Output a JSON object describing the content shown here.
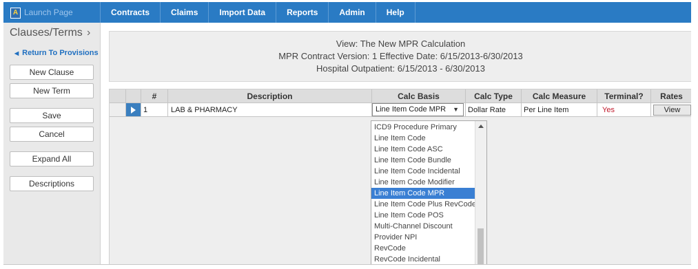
{
  "app": {
    "launch_label": "Launch Page",
    "logo_letter": "A"
  },
  "nav": {
    "items": [
      {
        "label": "Contracts"
      },
      {
        "label": "Claims"
      },
      {
        "label": "Import Data"
      },
      {
        "label": "Reports"
      },
      {
        "label": "Admin"
      },
      {
        "label": "Help"
      }
    ]
  },
  "sidebar": {
    "title": "Clauses/Terms",
    "chevron_icon": "chevron-right-icon",
    "return_link": "Return To Provisions",
    "buttons": {
      "new_clause": "New Clause",
      "new_term": "New Term",
      "save": "Save",
      "cancel": "Cancel",
      "expand_all": "Expand All",
      "descriptions": "Descriptions"
    }
  },
  "header": {
    "line1": "View: The New MPR Calculation",
    "line2": "MPR Contract Version: 1 Effective Date: 6/15/2013-6/30/2013",
    "line3": "Hospital Outpatient: 6/15/2013 - 6/30/2013"
  },
  "grid": {
    "columns": {
      "num": "#",
      "description": "Description",
      "calc_basis": "Calc Basis",
      "calc_type": "Calc Type",
      "calc_measure": "Calc Measure",
      "terminal": "Terminal?",
      "rates": "Rates"
    },
    "row": {
      "num": "1",
      "description": "LAB & PHARMACY",
      "calc_basis": "Line Item Code MPR",
      "calc_type": "Dollar Rate",
      "calc_measure": "Per Line Item",
      "terminal": "Yes",
      "rates_button": "View"
    }
  },
  "calc_basis_options": [
    "ICD9 Procedure Primary",
    "Line Item Code",
    "Line Item Code ASC",
    "Line Item Code Bundle",
    "Line Item Code Incidental",
    "Line Item Code Modifier",
    "Line Item Code MPR",
    "Line Item Code Plus RevCode",
    "Line Item Code POS",
    "Multi-Channel Discount",
    "Provider NPI",
    "RevCode",
    "RevCode Incidental"
  ],
  "calc_basis_selected": "Line Item Code MPR",
  "colors": {
    "nav_bg": "#2a7bc4",
    "selected_bg": "#3a7fd3",
    "terminal_yes": "#c0182a",
    "link": "#1f6fc0"
  }
}
